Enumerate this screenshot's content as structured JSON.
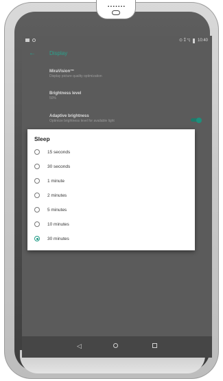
{
  "status_bar": {
    "time": "10:40",
    "right_icons": "⊙ ⁑ ◹"
  },
  "app_bar": {
    "back_glyph": "←",
    "title": "Display"
  },
  "preferences": [
    {
      "title": "MiraVision™",
      "subtitle": "Display picture quality optimization"
    },
    {
      "title": "Brightness level",
      "subtitle": "50%"
    },
    {
      "title": "Adaptive brightness",
      "subtitle": "Optimize brightness level for available light"
    }
  ],
  "adaptive_brightness_enabled": true,
  "dialog": {
    "title": "Sleep",
    "options": [
      "15 seconds",
      "30 seconds",
      "1 minute",
      "2 minutes",
      "5 minutes",
      "10 minutes",
      "30 minutes"
    ],
    "selected": "30 minutes"
  },
  "nav_bar": {
    "back_glyph": "◁"
  },
  "colors": {
    "accent": "#1e9a85",
    "screen_bg": "#5b5b5b",
    "dialog_bg": "#ffffff"
  }
}
